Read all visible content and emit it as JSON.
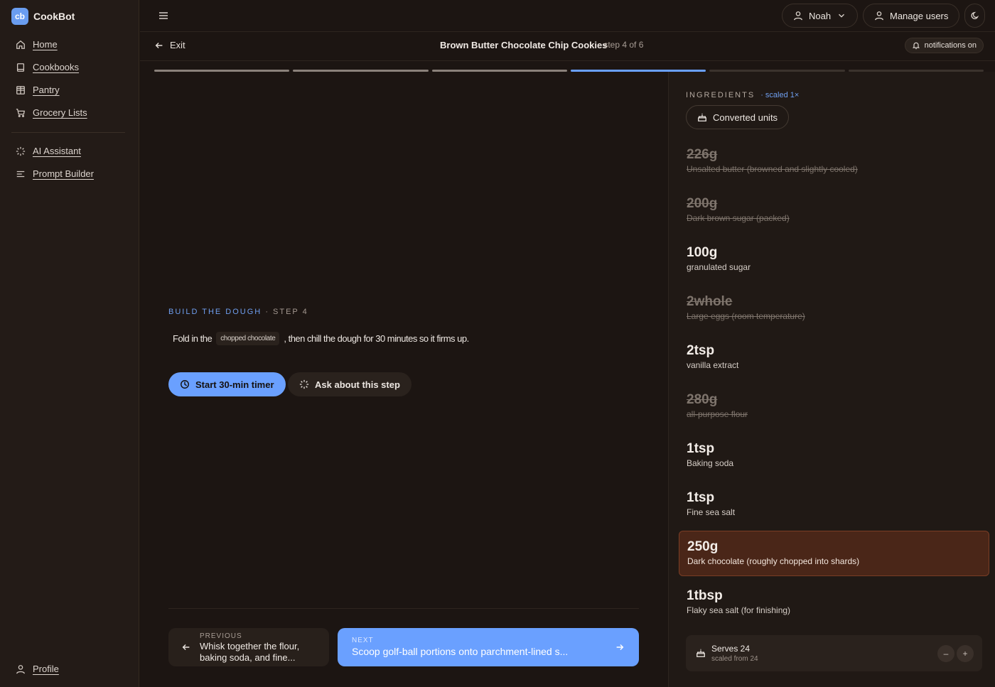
{
  "app": {
    "name": "CookBot",
    "logo_text": "cb"
  },
  "sidebar": {
    "items": [
      {
        "label": "Home",
        "icon": "home-icon"
      },
      {
        "label": "Cookbooks",
        "icon": "book-icon"
      },
      {
        "label": "Pantry",
        "icon": "grid-icon"
      },
      {
        "label": "Grocery Lists",
        "icon": "cart-icon"
      },
      {
        "label": "AI Assistant",
        "icon": "sparkle-icon"
      },
      {
        "label": "Prompt Builder",
        "icon": "lines-icon"
      }
    ],
    "profile": {
      "label": "Profile",
      "icon": "user-icon"
    }
  },
  "topbar": {
    "user_label": "Noah",
    "manage_users_label": "Manage users",
    "theme_icon": "moon-icon"
  },
  "step_header": {
    "exit_label": "Exit",
    "recipe_title": "Brown Butter Chocolate Chip Cookies",
    "step_count": "· step 4 of 6",
    "notifications_label": "notifications on"
  },
  "progress": {
    "total_steps": 6,
    "current_step": 4
  },
  "step": {
    "section": "BUILD THE DOUGH",
    "step_label": " · STEP 4",
    "text_before": "Fold in the",
    "chip": "chopped chocolate",
    "text_after": ", then chill the dough for 30 minutes so it firms up.",
    "timer_label": "Start 30-min timer",
    "ask_label": "Ask about this step"
  },
  "nav": {
    "previous_kicker": "PREVIOUS",
    "previous_text": "Whisk together the flour, baking soda, and fine...",
    "next_kicker": "NEXT",
    "next_text": "Scoop golf-ball portions onto parchment-lined s..."
  },
  "ingredients": {
    "heading": "INGREDIENTS",
    "scaled_label": "· scaled 1×",
    "converted_label": "Converted units",
    "items": [
      {
        "qty": "226g",
        "name": "Unsalted butter (browned and slightly cooled)",
        "state": "struck"
      },
      {
        "qty": "200g",
        "name": "Dark brown sugar (packed)",
        "state": "struck"
      },
      {
        "qty": "100g",
        "name": "granulated sugar",
        "state": "normal"
      },
      {
        "qty": "2whole",
        "name": "Large eggs (room temperature)",
        "state": "struck"
      },
      {
        "qty": "2tsp",
        "name": "vanilla extract",
        "state": "normal"
      },
      {
        "qty": "280g",
        "name": "all-purpose flour",
        "state": "struck"
      },
      {
        "qty": "1tsp",
        "name": "Baking soda",
        "state": "normal"
      },
      {
        "qty": "1tsp",
        "name": "Fine sea salt",
        "state": "normal"
      },
      {
        "qty": "250g",
        "name": "Dark chocolate (roughly chopped into shards)",
        "state": "highlight"
      },
      {
        "qty": "1tbsp",
        "name": "Flaky sea salt (for finishing)",
        "state": "normal"
      }
    ],
    "serves_label": "Serves 24",
    "scaled_from": "scaled from 24",
    "minus": "–",
    "plus": "+"
  },
  "colors": {
    "accent": "#6aa0ff",
    "background": "#1c1512",
    "highlight": "#4a2618"
  }
}
